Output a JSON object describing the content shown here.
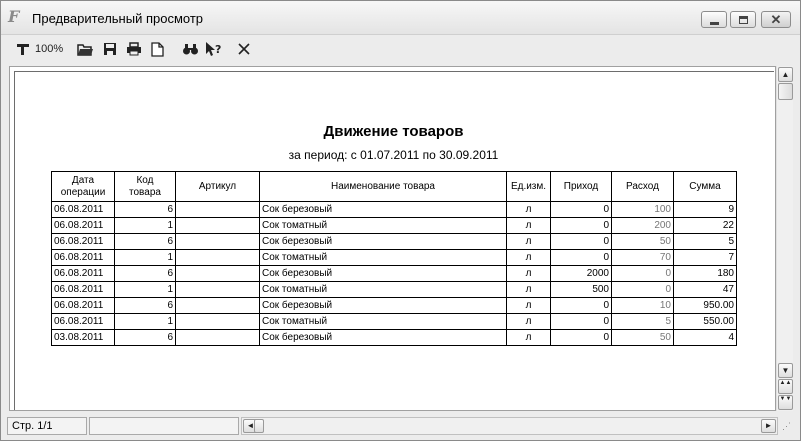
{
  "window": {
    "title": "Предварительный просмотр",
    "app_icon": "F",
    "controls": {
      "minimize_icon": "minimize-icon",
      "maximize_icon": "maximize-icon",
      "close_icon": "close-icon",
      "close_glyph": "✕"
    }
  },
  "toolbar": {
    "zoom_label": "100%",
    "icons": [
      "zoom-icon",
      "open-folder-icon",
      "save-icon",
      "print-icon",
      "new-page-icon",
      "find-icon",
      "help-cursor-icon",
      "close-icon"
    ]
  },
  "report": {
    "title": "Движение товаров",
    "period": "за период: с 01.07.2011 по 30.09.2011",
    "columns": {
      "date": [
        "Дата",
        "операции"
      ],
      "code": [
        "Код",
        "товара"
      ],
      "article": "Артикул",
      "name": "Наименование товара",
      "unit": "Ед.изм.",
      "income": "Приход",
      "expense": "Расход",
      "sum": "Сумма"
    },
    "rows": [
      {
        "date": "06.08.2011",
        "code": "6",
        "article": "",
        "name": "Сок березовый",
        "unit": "л",
        "income": "0",
        "expense": "100",
        "sum": "9"
      },
      {
        "date": "06.08.2011",
        "code": "1",
        "article": "",
        "name": "Сок томатный",
        "unit": "л",
        "income": "0",
        "expense": "200",
        "sum": "22"
      },
      {
        "date": "06.08.2011",
        "code": "6",
        "article": "",
        "name": "Сок березовый",
        "unit": "л",
        "income": "0",
        "expense": "50",
        "sum": "5"
      },
      {
        "date": "06.08.2011",
        "code": "1",
        "article": "",
        "name": "Сок томатный",
        "unit": "л",
        "income": "0",
        "expense": "70",
        "sum": "7"
      },
      {
        "date": "06.08.2011",
        "code": "6",
        "article": "",
        "name": "Сок березовый",
        "unit": "л",
        "income": "2000",
        "expense": "0",
        "sum": "180"
      },
      {
        "date": "06.08.2011",
        "code": "1",
        "article": "",
        "name": "Сок томатный",
        "unit": "л",
        "income": "500",
        "expense": "0",
        "sum": "47"
      },
      {
        "date": "06.08.2011",
        "code": "6",
        "article": "",
        "name": "Сок березовый",
        "unit": "л",
        "income": "0",
        "expense": "10",
        "sum": "950.00"
      },
      {
        "date": "06.08.2011",
        "code": "1",
        "article": "",
        "name": "Сок томатный",
        "unit": "л",
        "income": "0",
        "expense": "5",
        "sum": "550.00"
      },
      {
        "date": "03.08.2011",
        "code": "6",
        "article": "",
        "name": "Сок березовый",
        "unit": "л",
        "income": "0",
        "expense": "50",
        "sum": "4"
      }
    ]
  },
  "scrollbar": {
    "up": "▲",
    "down": "▼",
    "page_up": "▲▲",
    "page_down": "▼▼"
  },
  "hscrollbar": {
    "left": "◄",
    "right": "►"
  },
  "status": {
    "page": "Стр. 1/1"
  },
  "colors": {
    "expense_text": "#777777"
  }
}
